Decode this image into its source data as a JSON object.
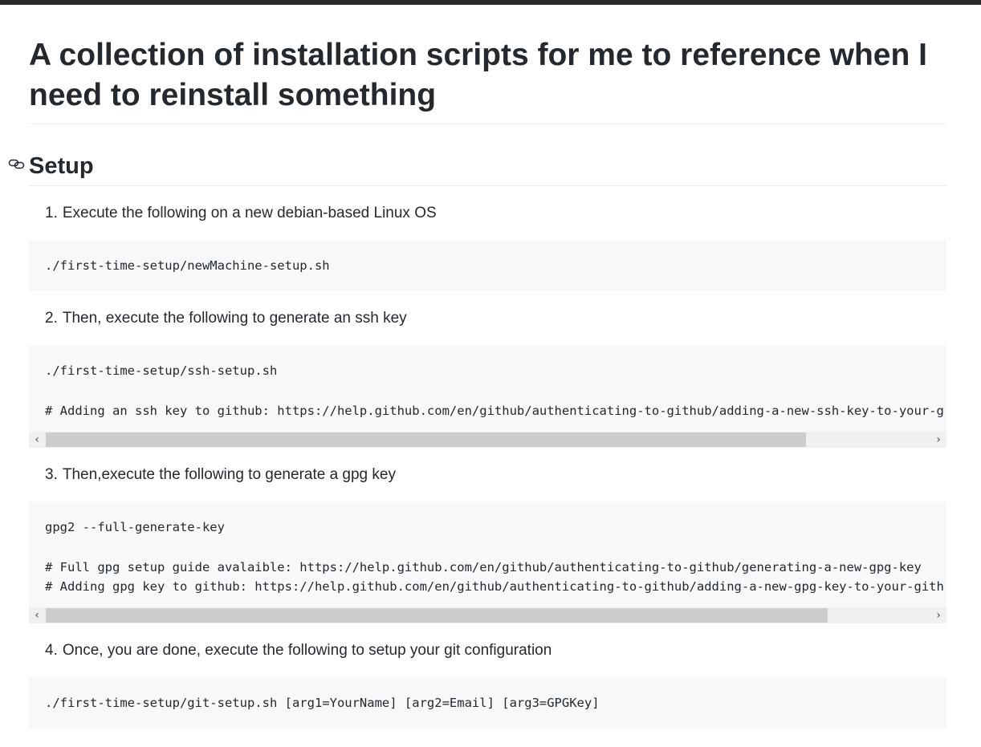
{
  "page": {
    "title": "A collection of installation scripts for me to reference when I need to reinstall something",
    "section_heading": "Setup",
    "anchor_icon": "link-icon"
  },
  "steps": [
    {
      "number": "1.",
      "text": "Execute the following on a new debian-based Linux OS",
      "code": [
        "./first-time-setup/newMachine-setup.sh"
      ],
      "scrollbar": false
    },
    {
      "number": "2.",
      "text": "Then, execute the following to generate an ssh key",
      "code": [
        "./first-time-setup/ssh-setup.sh",
        "",
        "# Adding an ssh key to github: https://help.github.com/en/github/authenticating-to-github/adding-a-new-ssh-key-to-your-g"
      ],
      "scrollbar": true,
      "scroll_thumb_fraction": 0.86
    },
    {
      "number": "3.",
      "text": "Then,execute the following to generate a gpg key",
      "code": [
        "gpg2 --full-generate-key",
        "",
        "# Full gpg setup guide avalaible: https://help.github.com/en/github/authenticating-to-github/generating-a-new-gpg-key",
        "# Adding gpg key to github: https://help.github.com/en/github/authenticating-to-github/adding-a-new-gpg-key-to-your-gith"
      ],
      "scrollbar": true,
      "scroll_thumb_fraction": 0.885
    },
    {
      "number": "4.",
      "text": "Once, you are done, execute the following to setup your git configuration",
      "code": [
        "./first-time-setup/git-setup.sh [arg1=YourName] [arg2=Email] [arg3=GPGKey]"
      ],
      "scrollbar": false
    }
  ],
  "scrollbar_icons": {
    "left": "chevron-left-icon",
    "right": "chevron-right-icon"
  },
  "colors": {
    "code_background": "#f6f8fa",
    "text": "#24292e",
    "divider": "#eaecef"
  }
}
